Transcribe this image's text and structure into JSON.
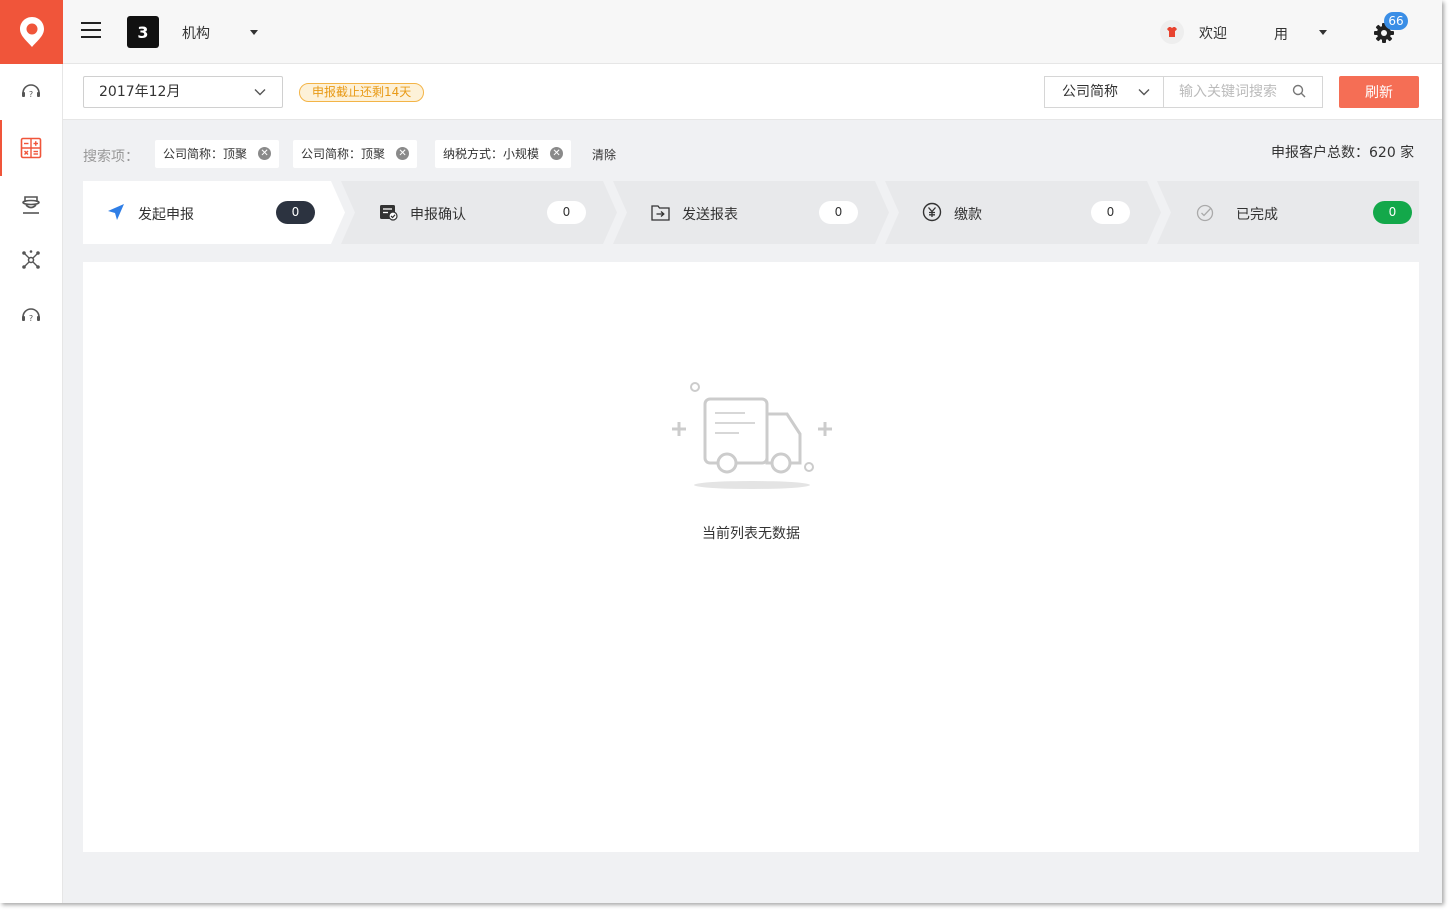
{
  "header": {
    "org_logo_text": "3",
    "org_name": "机构",
    "welcome": "欢迎",
    "user_name": "用",
    "notification_count": "66"
  },
  "toolbar": {
    "month": "2017年12月",
    "deadline_badge": "申报截止还剩14天",
    "company_field": "公司简称",
    "search_placeholder": "输入关键词搜索",
    "refresh_label": "刷新"
  },
  "filters": {
    "label": "搜索项：",
    "chips": [
      "公司简称：顶聚",
      "公司简称：顶聚",
      "纳税方式：小规模"
    ],
    "clear_label": "清除",
    "total": "申报客户总数：620 家"
  },
  "steps": [
    {
      "label": "发起申报",
      "count": "0",
      "icon": "send-icon"
    },
    {
      "label": "申报确认",
      "count": "0",
      "icon": "confirm-icon"
    },
    {
      "label": "发送报表",
      "count": "0",
      "icon": "send-report-icon"
    },
    {
      "label": "缴款",
      "count": "0",
      "icon": "yuan-icon"
    },
    {
      "label": "已完成",
      "count": "0",
      "icon": "check-icon"
    }
  ],
  "content": {
    "empty_text": "当前列表无数据"
  },
  "colors": {
    "brand": "#f0553a",
    "refresh": "#f56e55",
    "deadline_text": "#e89a17",
    "badge_blue": "#3a8ee6",
    "done_green": "#13a84a",
    "dark_pill": "#2c3340"
  }
}
